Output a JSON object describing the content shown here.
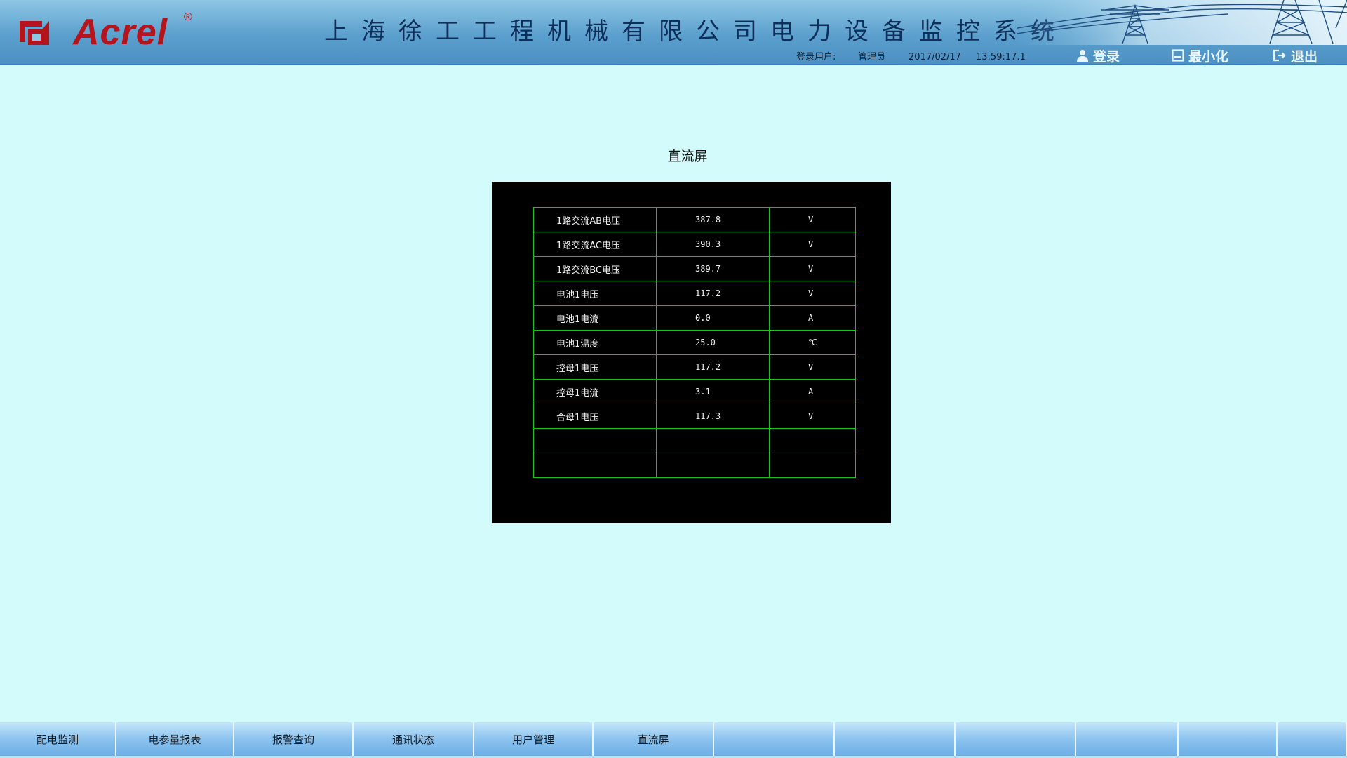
{
  "header": {
    "logo_text": "Acrel",
    "logo_reg": "®",
    "title": "上海徐工工程机械有限公司电力设备监控系统",
    "status": {
      "user_label": "登录用户:",
      "user": "管理员",
      "date": "2017/02/17",
      "time": "13:59:17.1"
    },
    "buttons": {
      "login": "登录",
      "minimize": "最小化",
      "exit": "退出"
    }
  },
  "colors": {
    "logo_red": "#b5141c",
    "page_bg": "#d4fbfb",
    "grid_green": "#18c418",
    "panel_bg": "#000000"
  },
  "page": {
    "title": "直流屏"
  },
  "table": {
    "rows": [
      {
        "name": "1路交流AB电压",
        "value": "387.8",
        "unit": "V"
      },
      {
        "name": "1路交流AC电压",
        "value": "390.3",
        "unit": "V"
      },
      {
        "name": "1路交流BC电压",
        "value": "389.7",
        "unit": "V"
      },
      {
        "name": "电池1电压",
        "value": "117.2",
        "unit": "V"
      },
      {
        "name": "电池1电流",
        "value": "0.0",
        "unit": "A"
      },
      {
        "name": "电池1温度",
        "value": "25.0",
        "unit": "℃"
      },
      {
        "name": "控母1电压",
        "value": "117.2",
        "unit": "V"
      },
      {
        "name": "控母1电流",
        "value": "3.1",
        "unit": "A"
      },
      {
        "name": "合母1电压",
        "value": "117.3",
        "unit": "V"
      },
      {
        "name": "",
        "value": "",
        "unit": ""
      },
      {
        "name": "",
        "value": "",
        "unit": ""
      }
    ]
  },
  "nav": {
    "items": [
      {
        "label": "配电监测"
      },
      {
        "label": "电参量报表"
      },
      {
        "label": "报警查询"
      },
      {
        "label": "通讯状态"
      },
      {
        "label": "用户管理"
      },
      {
        "label": "直流屏"
      },
      {
        "label": ""
      },
      {
        "label": ""
      },
      {
        "label": ""
      },
      {
        "label": ""
      },
      {
        "label": ""
      },
      {
        "label": ""
      }
    ]
  },
  "icons": {
    "logo": "acrel-logo-icon",
    "login": "user-icon",
    "minimize": "minimize-icon",
    "exit": "exit-icon",
    "decor": "power-tower-icon"
  }
}
